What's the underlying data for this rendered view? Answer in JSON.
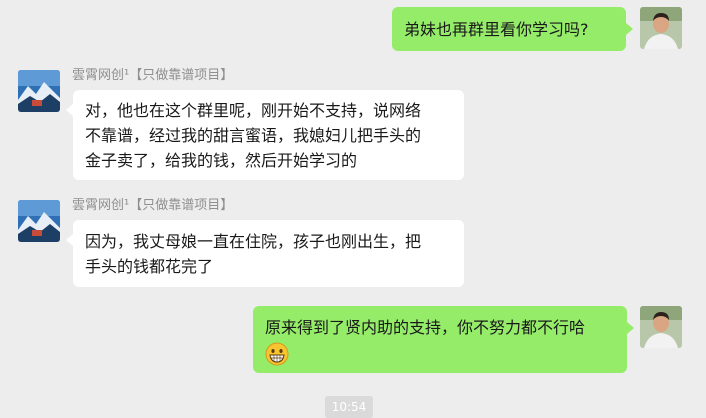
{
  "messages": [
    {
      "direction": "out",
      "text": "弟妹也再群里看你学习吗?",
      "avatar": "me-avatar"
    },
    {
      "direction": "in",
      "sender": "雲霄网创¹【只做靠谱项目】",
      "lines": [
        "对，他也在这个群里呢，刚开始不支持，说网络",
        "不靠谱，经过我的甜言蜜语，我媳妇儿把手头的",
        "金子卖了，给我的钱，然后开始学习的"
      ]
    },
    {
      "direction": "in",
      "sender": "雲霄网创¹【只做靠谱项目】",
      "lines": [
        "因为，我丈母娘一直在住院，孩子也刚出生，把",
        "手头的钱都花完了"
      ]
    },
    {
      "direction": "out",
      "lines": [
        "原来得到了贤内助的支持，你不努力都不行哈"
      ],
      "emoji": "grinning-face-emoji"
    }
  ],
  "timestamp": "10:54",
  "colors": {
    "background": "#ededed",
    "outgoing_bubble": "#95ec69",
    "incoming_bubble": "#ffffff",
    "sender_name": "#8f8f8f"
  }
}
